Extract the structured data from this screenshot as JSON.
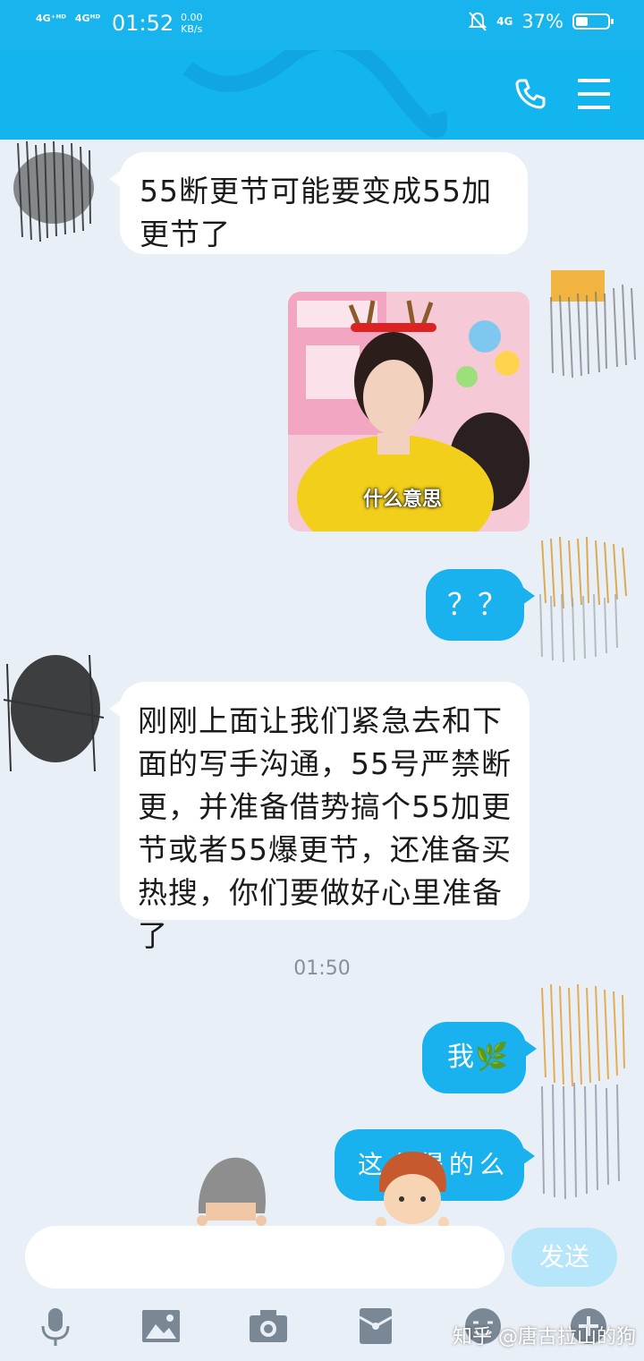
{
  "status": {
    "net1": "4G⁺ᴴᴰ",
    "net2": "4Gᴴᴰ",
    "time": "01:52",
    "speed_value": "0.00",
    "speed_unit": "KB/s",
    "net3": "4G",
    "battery": "37%",
    "battery_level": 0.37
  },
  "header": {
    "call_icon": "phone-icon",
    "menu_icon": "menu-icon"
  },
  "messages": [
    {
      "side": "in",
      "text": "55断更节可能要变成55加更节了"
    },
    {
      "side": "out",
      "type": "image",
      "caption": "什么意思"
    },
    {
      "side": "out",
      "text": "？？"
    },
    {
      "side": "in",
      "text": "刚刚上面让我们紧急去和下面的写手沟通，55号严禁断更，并准备借势搞个55加更节或者55爆更节，还准备买热搜，你们要做好心里准备了"
    },
    {
      "side": "out",
      "text": "我🌿"
    },
    {
      "side": "out",
      "text": "这么得的么"
    }
  ],
  "timestamp": "01:50",
  "composer": {
    "input_value": "",
    "send_label": "发送"
  },
  "toolbar": {
    "icons": [
      "microphone-icon",
      "image-icon",
      "camera-icon",
      "red-packet-icon",
      "emoji-icon",
      "plus-icon"
    ]
  },
  "watermark": "知乎 @唐古拉山的狗"
}
